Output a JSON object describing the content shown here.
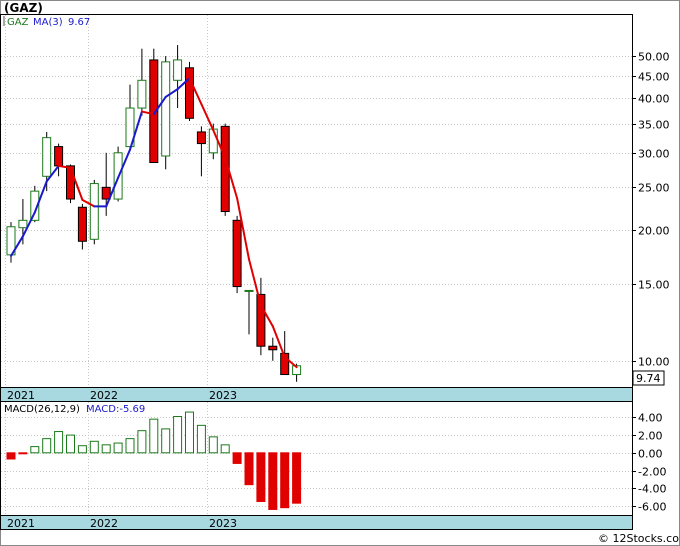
{
  "ticker_title": "(GAZ)",
  "watermark": "© 12Stocks.com",
  "price_panel": {
    "legend_symbol": "GAZ",
    "legend_ma": "MA(3)",
    "legend_ma_value": "9.67",
    "last_price_label": "9.74"
  },
  "macd_panel": {
    "legend_params": "MACD(26,12,9)",
    "legend_value": "MACD:-5.69"
  },
  "colors": {
    "up": "#1a7a1a",
    "down": "#e00000",
    "ma_up": "#1a1acc",
    "ma_down": "#e00000",
    "macd_pos": "#1a7a1a",
    "macd_neg": "#e00000",
    "axis_band": "#a8d8e0",
    "grid": "#c8c8c8"
  },
  "chart_data": [
    {
      "type": "candlestick",
      "title": "(GAZ)",
      "scale": "log",
      "ylim": [
        8.8,
        58
      ],
      "y_ticks": [
        10,
        15,
        20,
        25,
        30,
        35,
        40,
        45,
        50
      ],
      "y_tick_labels": [
        "10.00",
        "15.00",
        "20.00",
        "25.00",
        "30.00",
        "35.00",
        "40.00",
        "45.00",
        "50.00"
      ],
      "x_labels": [
        "2021",
        "2022",
        "2023"
      ],
      "x_label_positions": [
        0,
        7,
        17
      ],
      "candles": [
        {
          "o": 17.5,
          "h": 20.8,
          "l": 16.8,
          "c": 20.3
        },
        {
          "o": 20.2,
          "h": 23.5,
          "l": 18.5,
          "c": 21.0
        },
        {
          "o": 21.0,
          "h": 25.2,
          "l": 20.8,
          "c": 24.5
        },
        {
          "o": 26.5,
          "h": 33.5,
          "l": 24.5,
          "c": 32.5
        },
        {
          "o": 31.0,
          "h": 31.5,
          "l": 26.5,
          "c": 28.0
        },
        {
          "o": 28.0,
          "h": 28.2,
          "l": 23.0,
          "c": 23.5
        },
        {
          "o": 22.5,
          "h": 22.9,
          "l": 18.0,
          "c": 18.8
        },
        {
          "o": 19.0,
          "h": 26.0,
          "l": 18.5,
          "c": 25.5
        },
        {
          "o": 25.0,
          "h": 30.0,
          "l": 21.5,
          "c": 23.5
        },
        {
          "o": 23.5,
          "h": 31.0,
          "l": 23.2,
          "c": 30.0
        },
        {
          "o": 31.0,
          "h": 43.0,
          "l": 30.5,
          "c": 38.0
        },
        {
          "o": 38.0,
          "h": 52.0,
          "l": 36.5,
          "c": 44.0
        },
        {
          "o": 49.0,
          "h": 52.0,
          "l": 28.5,
          "c": 28.5
        },
        {
          "o": 29.5,
          "h": 50.0,
          "l": 27.5,
          "c": 48.5
        },
        {
          "o": 44.0,
          "h": 53.0,
          "l": 38.0,
          "c": 49.0
        },
        {
          "o": 47.0,
          "h": 48.5,
          "l": 35.5,
          "c": 36.0
        },
        {
          "o": 33.5,
          "h": 34.5,
          "l": 26.5,
          "c": 31.5
        },
        {
          "o": 30.0,
          "h": 35.0,
          "l": 29.0,
          "c": 34.0
        },
        {
          "o": 34.5,
          "h": 35.0,
          "l": 21.5,
          "c": 22.0
        },
        {
          "o": 21.0,
          "h": 21.5,
          "l": 14.3,
          "c": 14.8
        },
        {
          "o": 14.5,
          "h": 14.5,
          "l": 11.5,
          "c": 14.5
        },
        {
          "o": 14.2,
          "h": 15.5,
          "l": 10.3,
          "c": 10.8
        },
        {
          "o": 10.8,
          "h": 11.3,
          "l": 10.0,
          "c": 10.6
        },
        {
          "o": 10.4,
          "h": 11.7,
          "l": 9.3,
          "c": 9.3
        },
        {
          "o": 9.3,
          "h": 9.85,
          "l": 8.95,
          "c": 9.74
        }
      ],
      "ma3": [
        17.4,
        19.3,
        21.9,
        25.8,
        28.0,
        27.7,
        23.4,
        22.6,
        22.6,
        26.3,
        30.5,
        37.3,
        36.8,
        40.3,
        42.0,
        44.5,
        38.8,
        33.8,
        29.2,
        23.6,
        17.1,
        13.4,
        12.0,
        10.2,
        9.67
      ]
    },
    {
      "type": "bar",
      "title": "MACD(26,12,9)",
      "ylim": [
        -6.8,
        5.4
      ],
      "y_ticks": [
        4,
        2,
        0,
        -2,
        -4,
        -6
      ],
      "y_tick_labels": [
        "4.00",
        "2.00",
        "0.00",
        "-2.00",
        "-4.00",
        "-6.00"
      ],
      "x_labels": [
        "2021",
        "2022",
        "2023"
      ],
      "values": [
        -0.7,
        -0.1,
        0.7,
        1.6,
        2.4,
        2.0,
        0.8,
        1.3,
        0.9,
        1.1,
        1.6,
        2.5,
        3.8,
        2.7,
        4.1,
        4.6,
        3.1,
        1.8,
        0.9,
        -1.2,
        -3.6,
        -5.5,
        -6.4,
        -6.2,
        -5.69
      ]
    }
  ]
}
